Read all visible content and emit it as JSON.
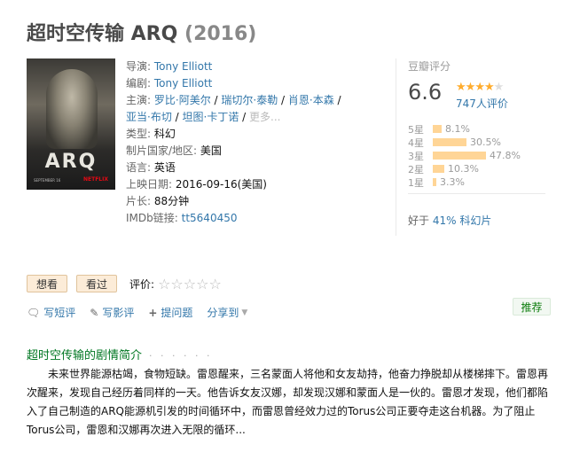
{
  "title": {
    "name": "超时空传输 ARQ",
    "year": "(2016)"
  },
  "poster": {
    "text": "ARQ",
    "small": "SEPTEMBER 16",
    "brand": "NETFLIX"
  },
  "info": {
    "director_label": "导演:",
    "director": "Tony Elliott",
    "writer_label": "编剧:",
    "writer": "Tony Elliott",
    "cast_label": "主演:",
    "cast": [
      "罗比·阿美尔",
      "瑞切尔·泰勒",
      "肖恩·本森",
      "亚当·布切",
      "坦图·卡丁诺"
    ],
    "cast_sep": " / ",
    "more": "更多...",
    "genre_label": "类型:",
    "genre": "科幻",
    "country_label": "制片国家/地区:",
    "country": "美国",
    "language_label": "语言:",
    "language": "英语",
    "release_label": "上映日期:",
    "release": "2016-09-16(美国)",
    "runtime_label": "片长:",
    "runtime": "88分钟",
    "imdb_label": "IMDb链接:",
    "imdb": "tt5640450"
  },
  "rating": {
    "label": "豆瓣评分",
    "score": "6.6",
    "stars_filled": 3.5,
    "count": "747人评价",
    "distribution": [
      {
        "label": "5星",
        "percent": "8.1%",
        "value": 8.1
      },
      {
        "label": "4星",
        "percent": "30.5%",
        "value": 30.5
      },
      {
        "label": "3星",
        "percent": "47.8%",
        "value": 47.8
      },
      {
        "label": "2星",
        "percent": "10.3%",
        "value": 10.3
      },
      {
        "label": "1星",
        "percent": "3.3%",
        "value": 3.3
      }
    ],
    "better_prefix": "好于",
    "better_link": "41% 科幻片"
  },
  "actions": {
    "want": "想看",
    "seen": "看过",
    "rate_label": "评价:",
    "rate_stars": "☆☆☆☆☆"
  },
  "links": {
    "short_review": "写短评",
    "review": "写影评",
    "ask": "提问题",
    "share": "分享到"
  },
  "recommend": "推荐",
  "summary": {
    "title": "超时空传输的剧情简介",
    "dots": "· · · · · ·",
    "text": "未来世界能源枯竭，食物短缺。雷恩醒来，三名蒙面人将他和女友劫持，他奋力挣脱却从楼梯摔下。雷恩再次醒来，发现自己经历着同样的一天。他告诉女友汉娜，却发现汉娜和蒙面人是一伙的。雷恩才发现，他们都陷入了自己制造的ARQ能源机引发的时间循环中，而雷恩曾经效力过的Torus公司正要夺走这台机器。为了阻止Torus公司，雷恩和汉娜再次进入无限的循环..."
  }
}
